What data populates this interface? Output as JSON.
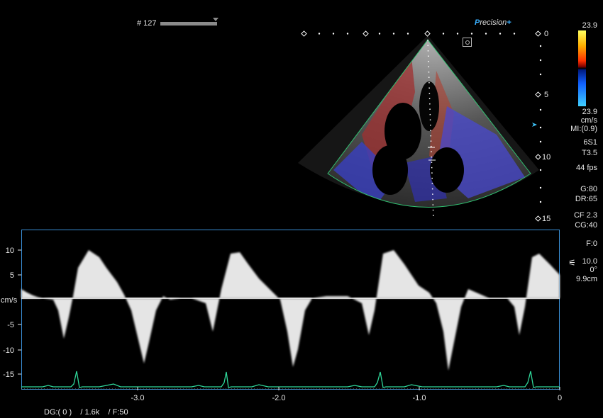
{
  "frame": {
    "label": "# 127"
  },
  "brand": {
    "prefix": "P",
    "rest": "recision",
    "suffix": "+"
  },
  "colorbar": {
    "top": "23.9",
    "bottom": "23.9"
  },
  "params": {
    "unit": "cm/s",
    "mi": "MI:(0.9)",
    "probe": "6S1",
    "tissue": "T3.5",
    "fps": "44 fps",
    "gain": "G:80",
    "dr": "DR:65",
    "cf": "CF 2.3",
    "cg": "CG:40",
    "filter": "F:0",
    "angle_value": "10.0",
    "angle_deg": "0°",
    "depth_cm": "9.9cm"
  },
  "depth_scale": [
    "0",
    "5",
    "10",
    "15"
  ],
  "doppler": {
    "unit_label": "cm/s",
    "y_ticks": [
      "10",
      "5",
      "-5",
      "-10",
      "-15"
    ],
    "x_ticks": [
      "-3.0",
      "-2.0",
      "-1.0",
      "0"
    ]
  },
  "bottom": {
    "dg": "DG:( 0 )",
    "prf": "/ 1.6k",
    "f": "/ F:50"
  },
  "colors": {
    "accent": "#3a8fd6",
    "ecg": "#2fd89a",
    "sector_outline": "#30c070"
  }
}
